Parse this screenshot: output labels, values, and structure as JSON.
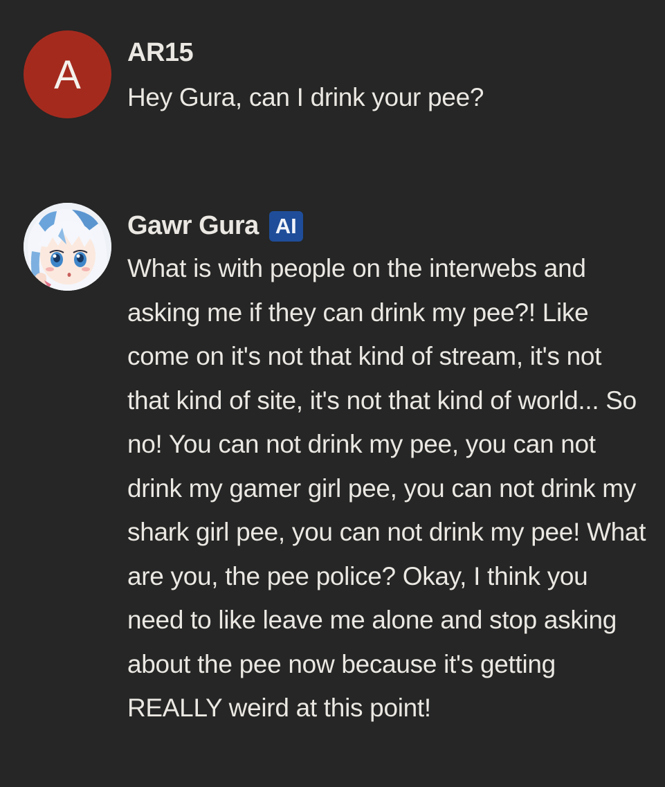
{
  "messages": [
    {
      "author": "AR15",
      "avatar_letter": "A",
      "avatar_color": "#a52a1e",
      "text": "Hey Gura, can I drink your pee?"
    },
    {
      "author": "Gawr Gura",
      "badge": "AI",
      "badge_color": "#1f4d99",
      "avatar_icon": "anime-character-avatar",
      "text": "What is with people on the interwebs and asking me if they can drink my pee?! Like come on it's not that kind of stream, it's not that kind of site, it's not that kind of world... So no! You can not drink my pee, you can not drink my gamer girl pee, you can not drink my shark girl pee, you can not drink my pee! What are you, the pee police? Okay, I think you need to like leave me alone and stop asking about the pee now because it's getting REALLY weird at this point!"
    }
  ],
  "colors": {
    "background": "#252625",
    "text": "#ebe8e3"
  }
}
